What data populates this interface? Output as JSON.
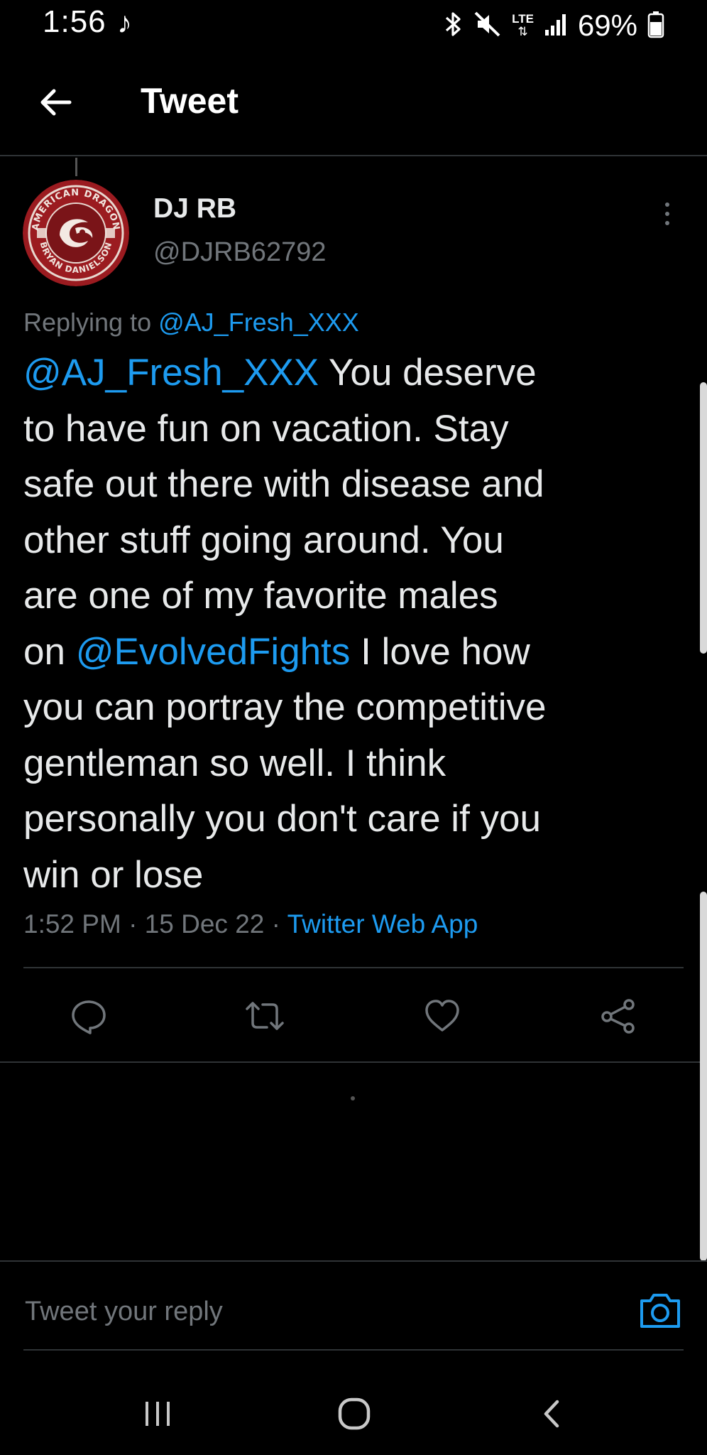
{
  "status_bar": {
    "time": "1:56",
    "note_icon": "music-note-icon",
    "lte_label": "LTE",
    "battery_percent": "69%",
    "battery_level": 0.69
  },
  "header": {
    "back_icon": "arrow-left-icon",
    "title": "Tweet"
  },
  "tweet": {
    "author": {
      "display_name": "DJ RB",
      "handle": "@DJRB62792",
      "avatar_badge_text": "AMERICAN DRAGON BRYAN DANIELSON"
    },
    "replying_prefix": "Replying to",
    "replying_to": "@AJ_Fresh_XXX",
    "body": {
      "line1_mention": "@AJ_Fresh_XXX",
      "line1_text": " You deserve",
      "line2": "to have fun on vacation. Stay",
      "line3": "safe out there with disease and",
      "line4": "other stuff going around. You",
      "line5": "are one of my favorite males",
      "line6_prefix": "on ",
      "line6_mention": "@EvolvedFights",
      "line6_text": " I love how",
      "line7": "you can portray the competitive",
      "line8": "gentleman so well. I think",
      "line9": "personally you don't care if you",
      "line10": "win or lose"
    },
    "time": "1:52 PM",
    "separator": " · ",
    "date": "15 Dec 22",
    "source": "Twitter Web App"
  },
  "actions": {
    "reply_icon": "reply-bubble-icon",
    "retweet_icon": "retweet-icon",
    "like_icon": "heart-icon",
    "share_icon": "share-icon"
  },
  "compose": {
    "placeholder": "Tweet your reply",
    "camera_icon": "camera-icon"
  },
  "nav_bar": {
    "recents_icon": "recents-icon",
    "home_icon": "home-icon",
    "back_icon": "back-chevron-icon"
  },
  "colors": {
    "background": "#000000",
    "accent": "#1d9bf0",
    "text": "#e7e9ea",
    "muted": "#71767b",
    "avatar_red": "#9b1b20"
  }
}
